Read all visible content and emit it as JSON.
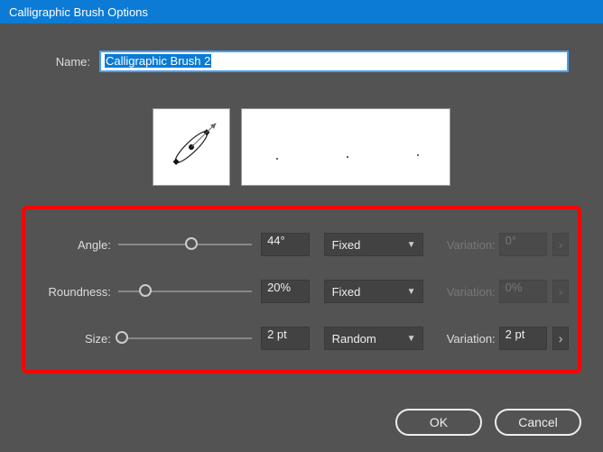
{
  "title": "Calligraphic Brush Options",
  "name": {
    "label": "Name:",
    "value": "Calligraphic Brush 2"
  },
  "params": {
    "angle": {
      "label": "Angle:",
      "value": "44°",
      "slider_pct": 55,
      "mode": "Fixed",
      "variation_label": "Variation:",
      "variation_value": "0°",
      "variation_enabled": false
    },
    "roundness": {
      "label": "Roundness:",
      "value": "20%",
      "slider_pct": 20,
      "mode": "Fixed",
      "variation_label": "Variation:",
      "variation_value": "0%",
      "variation_enabled": false
    },
    "size": {
      "label": "Size:",
      "value": "2 pt",
      "slider_pct": 3,
      "mode": "Random",
      "variation_label": "Variation:",
      "variation_value": "2 pt",
      "variation_enabled": true
    }
  },
  "buttons": {
    "ok": "OK",
    "cancel": "Cancel"
  }
}
